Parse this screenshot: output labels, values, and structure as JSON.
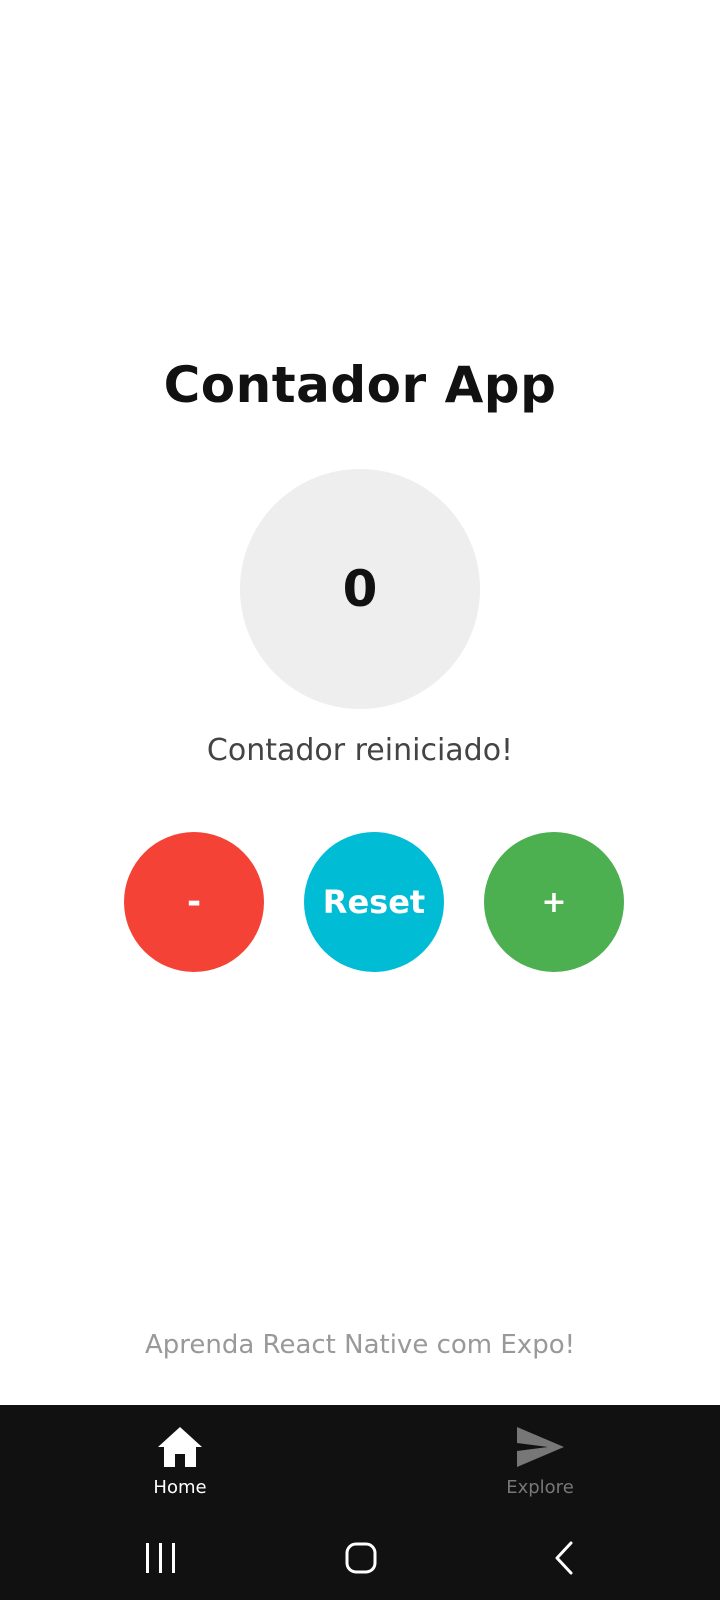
{
  "app": {
    "title": "Contador App"
  },
  "counter": {
    "value": "0",
    "status": "Contador reiniciado!"
  },
  "buttons": {
    "decrement_label": "-",
    "reset_label": "Reset",
    "increment_label": "+"
  },
  "footer": {
    "text": "Aprenda React Native com Expo!"
  },
  "tabbar": {
    "active_tab": "Home",
    "tabs": [
      {
        "label": "Home",
        "icon": "home-icon"
      },
      {
        "label": "Explore",
        "icon": "send-icon"
      }
    ]
  },
  "system_nav": {
    "icons": [
      "recent-apps-icon",
      "home-circle-icon",
      "back-icon"
    ]
  },
  "colors": {
    "decrement": "#f44336",
    "reset": "#00bcd4",
    "increment": "#4caf50",
    "counter_bg": "#eeeeee",
    "tabbar_bg": "#111111",
    "tab_active": "#ffffff",
    "tab_inactive": "#777777"
  }
}
